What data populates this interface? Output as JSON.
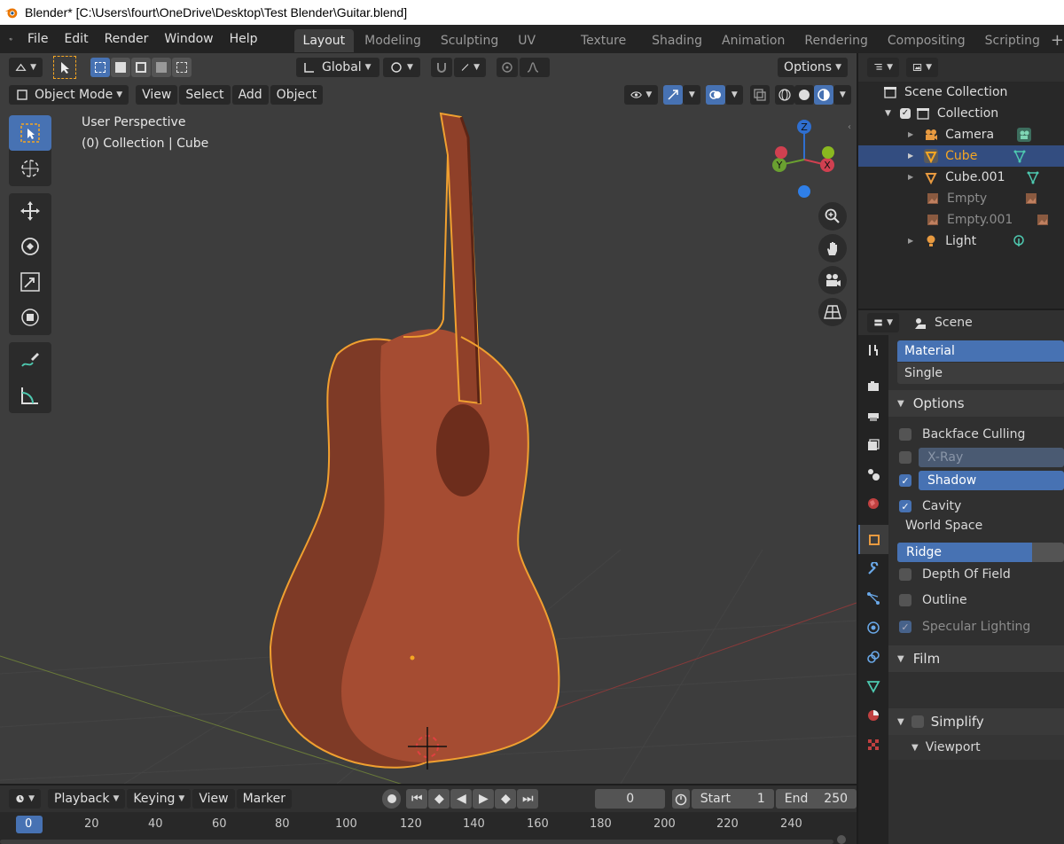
{
  "window": {
    "title": "Blender* [C:\\Users\\fourt\\OneDrive\\Desktop\\Test Blender\\Guitar.blend]"
  },
  "menu": [
    "File",
    "Edit",
    "Render",
    "Window",
    "Help"
  ],
  "workspaces": [
    "Layout",
    "Modeling",
    "Sculpting",
    "UV Editing",
    "Texture Paint",
    "Shading",
    "Animation",
    "Rendering",
    "Compositing",
    "Scripting"
  ],
  "active_workspace": "Layout",
  "viewport": {
    "transform_orientation": "Global",
    "options_label": "Options",
    "mode": "Object Mode",
    "header_menus": [
      "View",
      "Select",
      "Add",
      "Object"
    ],
    "perspective_label": "User Perspective",
    "collection_label": "(0) Collection | Cube",
    "gizmo_axes": {
      "x": "X",
      "y": "Y",
      "z": "Z"
    }
  },
  "outliner": {
    "items": [
      {
        "label": "Scene Collection"
      },
      {
        "label": "Collection"
      },
      {
        "label": "Camera"
      },
      {
        "label": "Cube"
      },
      {
        "label": "Cube.001"
      },
      {
        "label": "Empty"
      },
      {
        "label": "Empty.001"
      },
      {
        "label": "Light"
      }
    ]
  },
  "properties": {
    "context": "Scene",
    "color_options": [
      "Material",
      "Single"
    ],
    "options_panel": "Options",
    "backface_culling": "Backface Culling",
    "xray": "X-Ray",
    "shadow": "Shadow",
    "cavity": "Cavity",
    "world_space": "World Space",
    "ridge": "Ridge",
    "depth_of_field": "Depth Of Field",
    "outline": "Outline",
    "specular_lighting": "Specular Lighting",
    "film_panel": "Film",
    "simplify_panel": "Simplify",
    "viewport_subpanel": "Viewport"
  },
  "timeline": {
    "menus": [
      "Playback",
      "Keying",
      "View",
      "Marker"
    ],
    "current_frame": "0",
    "start_label": "Start",
    "start_value": "1",
    "end_label": "End",
    "end_value": "250",
    "ruler_labels": [
      "0",
      "20",
      "40",
      "60",
      "80",
      "100",
      "120",
      "140",
      "160",
      "180",
      "200",
      "220",
      "240"
    ]
  },
  "colors": {
    "accent": "#4772b3",
    "guitar_body": "#a54c32",
    "selection_outline": "#f0a030",
    "active_object": "#f5a623"
  }
}
